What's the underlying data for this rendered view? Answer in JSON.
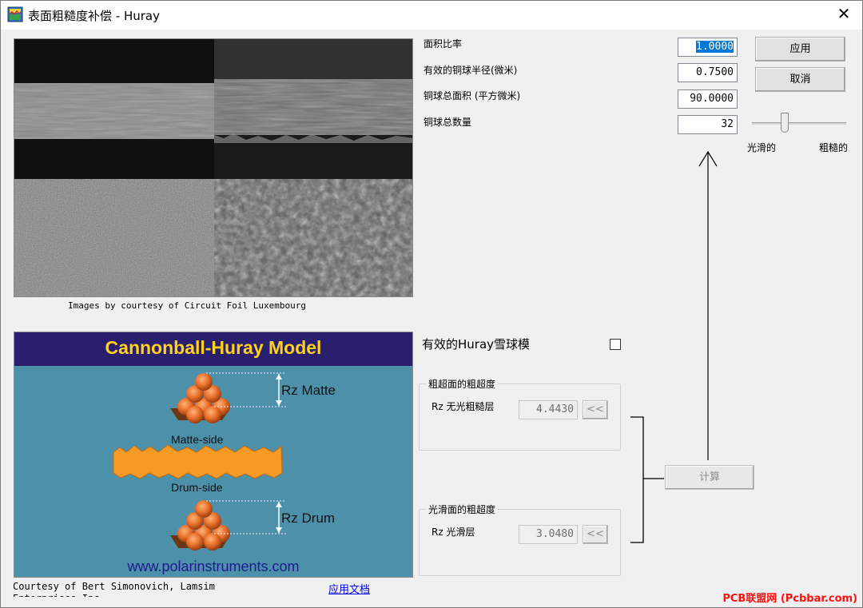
{
  "window": {
    "title": "表面粗糙度补偿 - Huray",
    "close_glyph": "✕"
  },
  "params": {
    "area_ratio_label": "面积比率",
    "area_ratio_value": "1.0000",
    "radius_label": "有效的铜球半径(微米)",
    "radius_value": "0.7500",
    "total_area_label": "铜球总面积  (平方微米)",
    "total_area_value": "90.0000",
    "count_label": "铜球总数量",
    "count_value": "32"
  },
  "buttons": {
    "apply": "应用",
    "cancel": "取消",
    "calculate": "计算",
    "copy_back": "<<"
  },
  "slider": {
    "left_label": "光滑的",
    "right_label": "粗糙的",
    "level": 0.32
  },
  "images": {
    "sem_caption": "Images by courtesy of Circuit Foil Luxembourg",
    "model_title": "Cannonball-Huray Model",
    "model_rz_matte": "Rz Matte",
    "model_matte_side": "Matte-side",
    "model_drum_side": "Drum-side",
    "model_rz_drum": "Rz Drum",
    "model_url": "www.polarinstruments.com",
    "courtesy": "Courtesy of Bert Simonovich, Lamsim Enterprises Inc."
  },
  "links": {
    "docs": "应用文档"
  },
  "huray": {
    "snowball_label": "有效的Huray雪球模",
    "snowball_checked": false
  },
  "rough_group": {
    "legend": "粗超面的粗超度",
    "rz_label": "Rz  无光粗糙层",
    "value": "4.4430"
  },
  "smooth_group": {
    "legend": "光滑面的粗超度",
    "rz_label": "Rz  光滑层",
    "value": "3.0480"
  },
  "watermark": "PCB联盟网 (Pcbbar.com)",
  "colors": {
    "selection": "#0078d7",
    "model_background": "#4d90aa",
    "model_header": "#2a1e6e",
    "model_title": "#ffd21c",
    "copper_sphere": "#e8702a",
    "watermark": "#ff1010"
  },
  "icons": {
    "app": "roughness-app-icon",
    "close": "close-icon",
    "arrow": "arrow-up-icon"
  }
}
